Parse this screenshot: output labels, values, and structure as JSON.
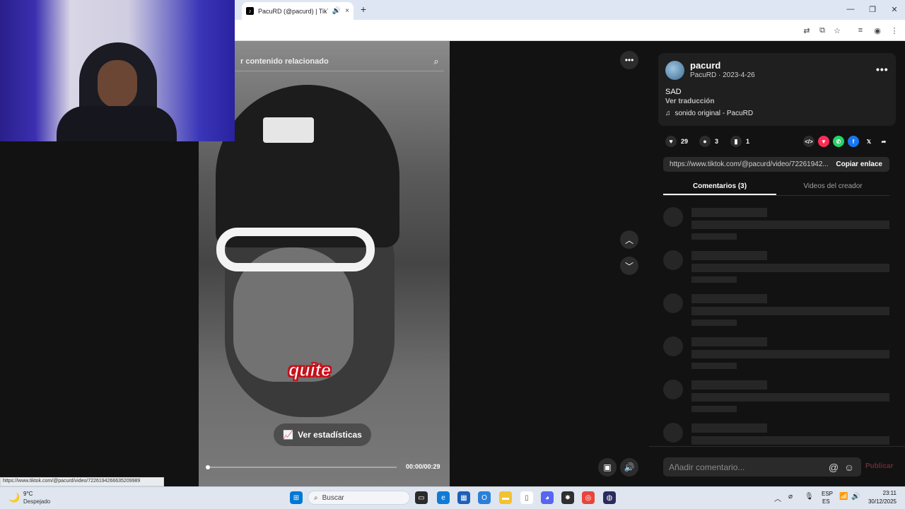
{
  "browser": {
    "tab_title": "PacuRD (@pacurd) | TikTok",
    "tab_audio_icon": "speaker-icon",
    "close_icon": "×",
    "new_tab": "+",
    "minimize": "—",
    "restore": "❐",
    "close_window": "✕"
  },
  "video": {
    "search_placeholder": "r contenido relacionado",
    "caption_text": "quite",
    "stats_button": "Ver estadísticas",
    "time": "00:00/00:29",
    "progress": 0.0,
    "status_url": "https://www.tiktok.com/@pacurd/video/7226194266635209989"
  },
  "post": {
    "username": "pacurd",
    "subline": "PacuRD · 2023-4-26",
    "description": "SAD",
    "translate": "Ver traducción",
    "sound": "sonido original - PacuRD",
    "likes": "29",
    "comments": "3",
    "saves": "1",
    "link": "https://www.tiktok.com/@pacurd/video/72261942...",
    "copy_link": "Copiar enlace",
    "tab_comments": "Comentarios (3)",
    "tab_creator": "Videos del creador",
    "comment_placeholder": "Añadir comentario...",
    "publish": "Publicar"
  },
  "taskbar": {
    "temperature": "9°C",
    "condition": "Despejado",
    "search": "Buscar",
    "lang_top": "ESP",
    "lang_bottom": "ES",
    "time": "23:11",
    "date": "30/12/2025"
  },
  "colors": {
    "tiktok_bg": "#121212",
    "accent_publish": "#fe2c55",
    "windows_blue": "#0078d4"
  }
}
